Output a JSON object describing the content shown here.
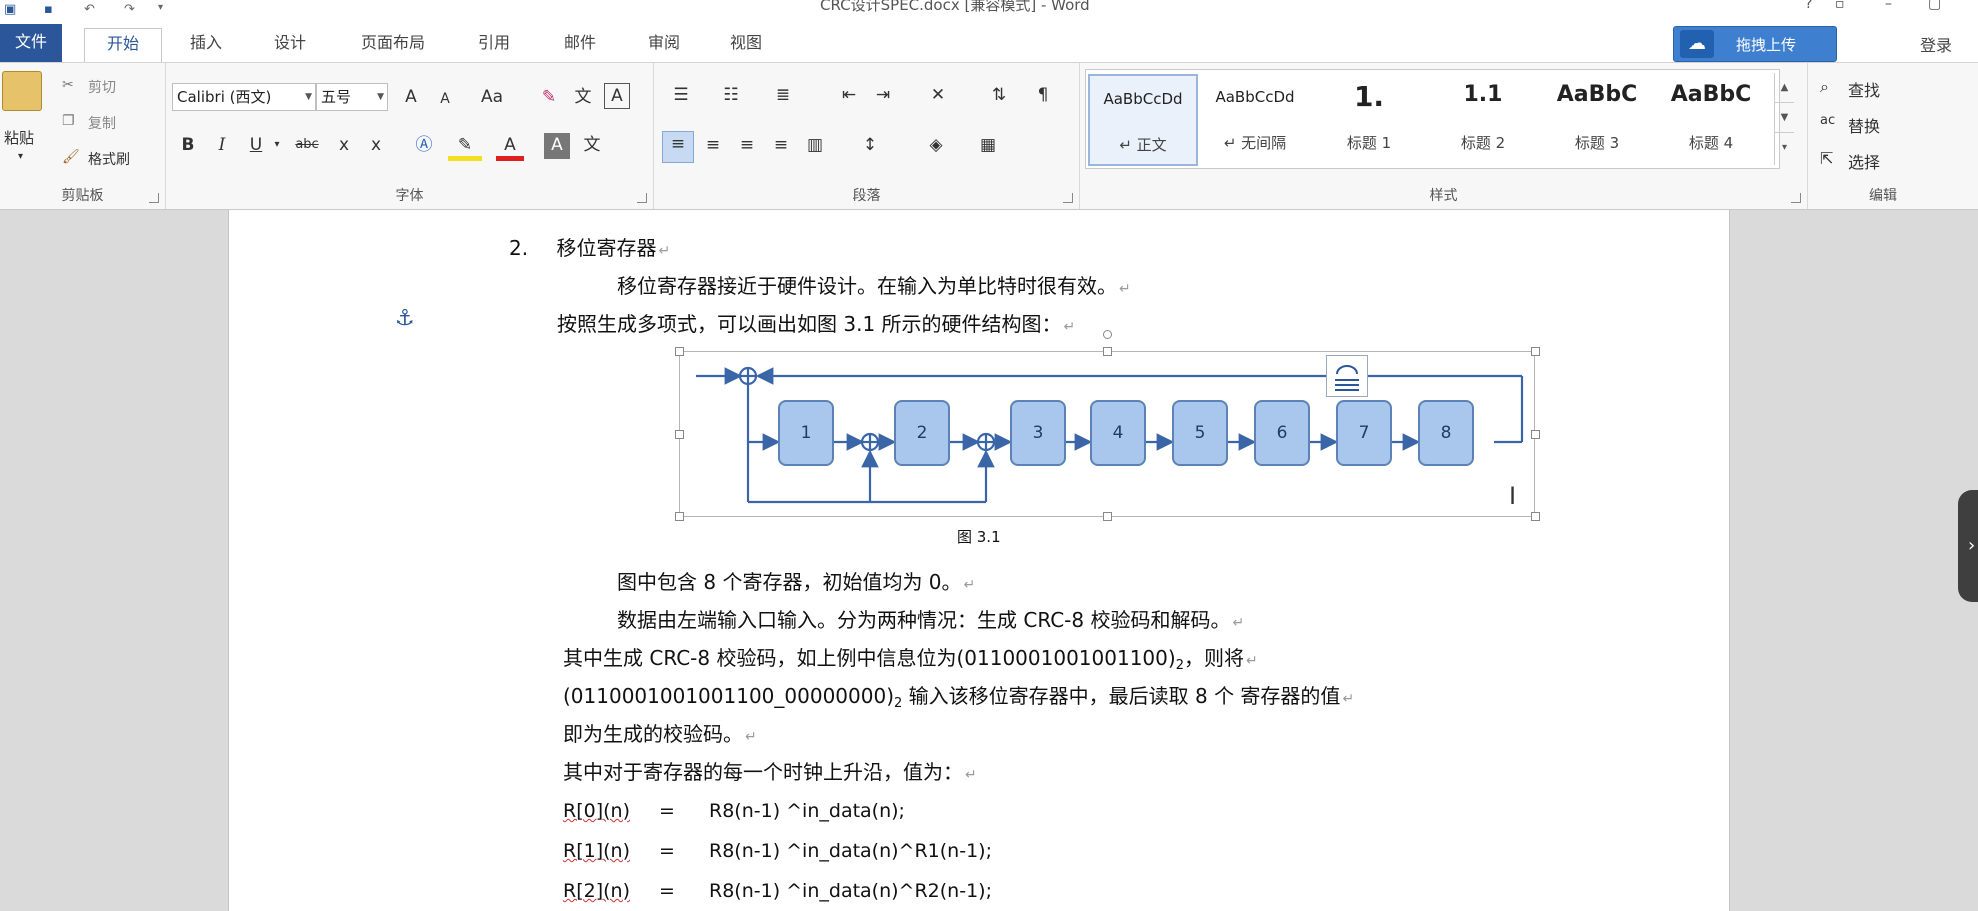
{
  "window": {
    "title": "CRC设计SPEC.docx [兼容模式] - Word",
    "qa_icons": [
      "word-logo-icon",
      "save-icon",
      "undo-icon",
      "redo-icon",
      "customize-icon"
    ]
  },
  "tabs": {
    "file": "文件",
    "home": "开始",
    "insert": "插入",
    "design": "设计",
    "layout": "页面布局",
    "references": "引用",
    "mailings": "邮件",
    "review": "审阅",
    "view": "视图"
  },
  "upload_button": "拖拽上传",
  "login": "登录",
  "clipboard": {
    "paste": "粘贴",
    "cut": "剪切",
    "copy": "复制",
    "format_painter": "格式刷",
    "label": "剪贴板"
  },
  "font": {
    "family": "Calibri (西文)",
    "size": "五号",
    "label": "字体",
    "grow": "A",
    "shrink": "A",
    "case": "Aa",
    "bold": "B",
    "italic": "I",
    "underline": "U",
    "strike": "abc",
    "subscript": "x",
    "superscript": "x",
    "color": "A",
    "phonetic": "文"
  },
  "paragraph": {
    "label": "段落"
  },
  "styles": {
    "label": "样式",
    "items": [
      {
        "sample": "AaBbCcDd",
        "name": "↵ 正文"
      },
      {
        "sample": "AaBbCcDd",
        "name": "↵ 无间隔"
      },
      {
        "sample": "1.",
        "name": "标题 1"
      },
      {
        "sample": "1.1",
        "name": "标题 2"
      },
      {
        "sample": "AaBbC",
        "name": "标题 3"
      },
      {
        "sample": "AaBbC",
        "name": "标题 4"
      }
    ]
  },
  "editing": {
    "find": "查找",
    "replace": "替换",
    "select": "选择",
    "label": "编辑"
  },
  "document": {
    "heading_num": "2.",
    "heading": "移位寄存器",
    "p1": "移位寄存器接近于硬件设计。在输入为单比特时很有效。",
    "p2": "按照生成多项式，可以画出如图 3.1 所示的硬件结构图：",
    "registers": [
      "1",
      "2",
      "3",
      "4",
      "5",
      "6",
      "7",
      "8"
    ],
    "caption": "图 3.1",
    "p3": "图中包含 8 个寄存器，初始值均为 0。",
    "p4": "数据由左端输入口输入。分为两种情况：生成 CRC-8 校验码和解码。",
    "p5a": "其中生成 CRC-8 校验码，如上例中信息位为(011000100100110",
    "p5b": "0)",
    "p5_sub": "2",
    "p5c": "，则将",
    "p6a": "(011000100100110",
    "p6b": "0_00000000)",
    "p6_sub": "2",
    "p6c": " 输入该移位寄存器中，最后读取 8 个  寄存器的值",
    "p7": "即为生成的校验码。",
    "p8": "其中对于寄存器的每一个时钟上升沿，值为：",
    "eq1_lhs": "R[0](n)",
    "eq1_rhs": "R8(n-1) ^in_data(n);",
    "eq2_lhs": "R[1](n)",
    "eq2_rhs": "R8(n-1) ^in_data(n)^R1(n-1);",
    "eq3_lhs": "R[2](n)",
    "eq3_rhs": "R8(n-1) ^in_data(n)^R2(n-1);",
    "eq_sign": "="
  },
  "paragraph_mark": "↵"
}
